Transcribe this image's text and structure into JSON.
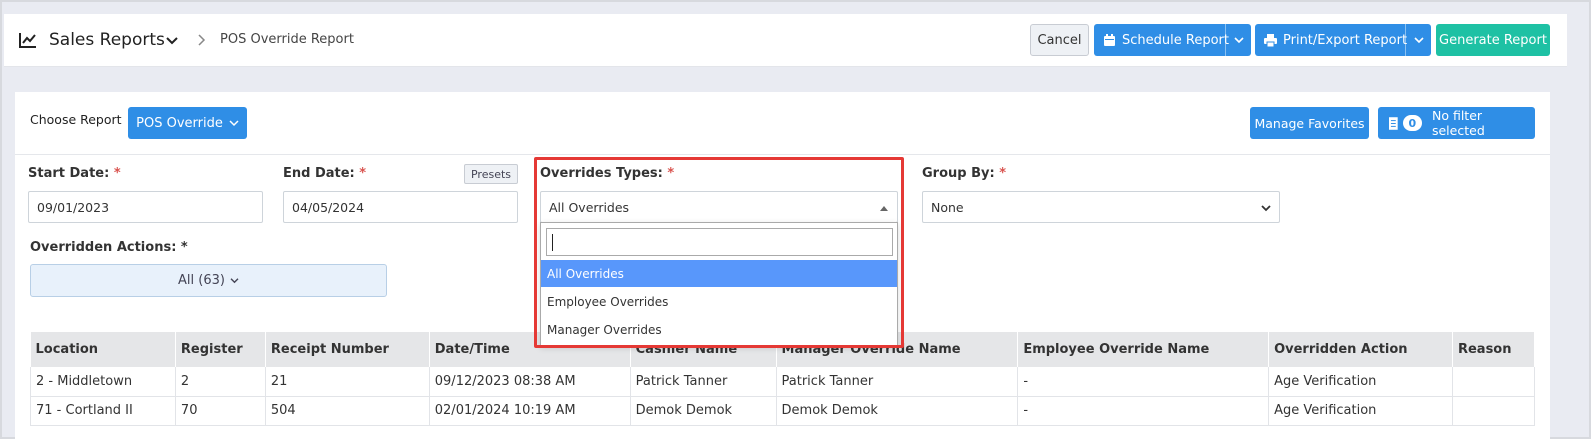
{
  "header": {
    "app_title": "Sales Reports",
    "breadcrumb": "POS Override Report",
    "cancel_label": "Cancel",
    "schedule_label": "Schedule Report",
    "print_label": "Print/Export Report",
    "generate_label": "Generate Report"
  },
  "toolbar": {
    "choose_label": "Choose Report",
    "report_selected": "POS Override",
    "favorites_label": "Manage Favorites",
    "filter_count": "0",
    "filter_label": "No filter selected"
  },
  "filters": {
    "start_label": "Start Date:",
    "start_value": "09/01/2023",
    "end_label": "End Date:",
    "end_value": "04/05/2024",
    "presets_label": "Presets",
    "overrides_label": "Overrides Types:",
    "overrides_value": "All Overrides",
    "groupby_label": "Group By:",
    "groupby_value": "None",
    "actions_label": "Overridden Actions: *",
    "actions_value": "All (63)",
    "required_mark": "*"
  },
  "dropdown": {
    "search_value": "",
    "options": [
      "All Overrides",
      "Employee Overrides",
      "Manager Overrides"
    ],
    "selected_index": 0
  },
  "table": {
    "columns": [
      "Location",
      "Register",
      "Receipt Number",
      "Date/Time",
      "Cashier Name",
      "Manager Override Name",
      "Employee Override Name",
      "Overridden Action",
      "Reason"
    ],
    "rows": [
      [
        "2 - Middletown",
        "2",
        "21",
        "09/12/2023 08:38 AM",
        "Patrick Tanner",
        "Patrick Tanner",
        "-",
        "Age Verification",
        ""
      ],
      [
        "71 - Cortland II",
        "70",
        "504",
        "02/01/2024 10:19 AM",
        "Demok Demok",
        "Demok Demok",
        "-",
        "Age Verification",
        ""
      ]
    ]
  },
  "colors": {
    "primary": "#2f8ee6",
    "success": "#1ec1a4",
    "highlight": "#e53935",
    "option_active": "#5897fb"
  }
}
